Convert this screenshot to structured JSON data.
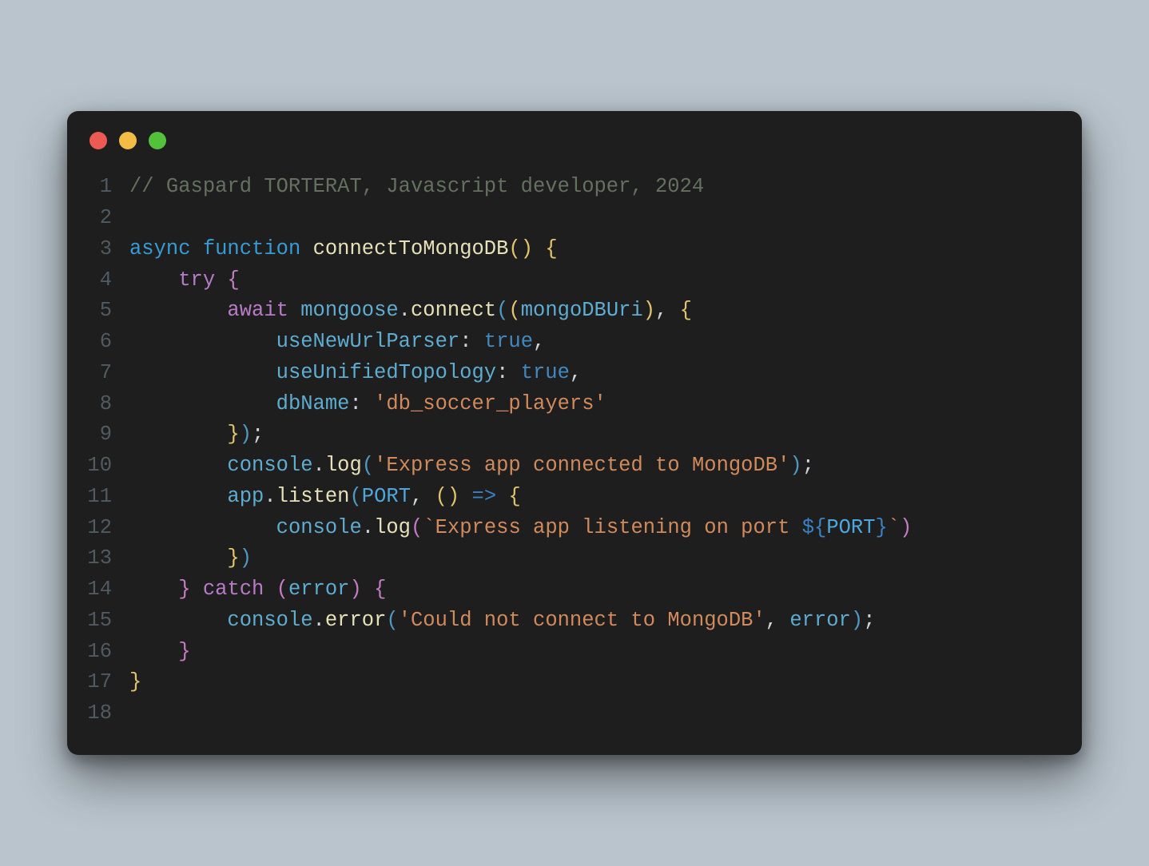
{
  "traffic_lights": {
    "red": "#ec5a53",
    "yellow": "#f1bd44",
    "green": "#54c13d"
  },
  "line_numbers": [
    "1",
    "2",
    "3",
    "4",
    "5",
    "6",
    "7",
    "8",
    "9",
    "10",
    "11",
    "12",
    "13",
    "14",
    "15",
    "16",
    "17",
    "18"
  ],
  "code": {
    "l1_comment": "// Gaspard TORTERAT, Javascript developer, 2024",
    "l3_async": "async",
    "l3_function": "function",
    "l3_name": "connectToMongoDB",
    "l3_parens": "()",
    "l3_brace": " {",
    "l4_try": "try",
    "l4_brace": " {",
    "l5_await": "await",
    "l5_mongoose": "mongoose",
    "l5_dot": ".",
    "l5_connect": "connect",
    "l5_open": "((",
    "l5_uri": "mongoDBUri",
    "l5_close_open": "), {",
    "l6_key": "useNewUrlParser",
    "l6_colon": ": ",
    "l6_val": "true",
    "l6_comma": ",",
    "l7_key": "useUnifiedTopology",
    "l7_colon": ": ",
    "l7_val": "true",
    "l7_comma": ",",
    "l8_key": "dbName",
    "l8_colon": ": ",
    "l8_val": "'db_soccer_players'",
    "l9_close": "});",
    "l10_console": "console",
    "l10_dot": ".",
    "l10_log": "log",
    "l10_p1": "(",
    "l10_str": "'Express app connected to MongoDB'",
    "l10_p2": ");",
    "l11_app": "app",
    "l11_dot": ".",
    "l11_listen": "listen",
    "l11_p1": "(",
    "l11_port": "PORT",
    "l11_comma": ", ",
    "l11_arrowp": "()",
    "l11_arrow": " => ",
    "l11_brace": "{",
    "l12_console": "console",
    "l12_dot": ".",
    "l12_log": "log",
    "l12_p1": "(",
    "l12_tick1": "`",
    "l12_str1": "Express app listening on port ",
    "l12_int_open": "${",
    "l12_port": "PORT",
    "l12_int_close": "}",
    "l12_tick2": "`",
    "l12_p2": ")",
    "l13_close": "})",
    "l14_brace_close": "}",
    "l14_catch": "catch",
    "l14_paren_o": " (",
    "l14_error": "error",
    "l14_paren_c": ")",
    "l14_brace_o": " {",
    "l15_console": "console",
    "l15_dot": ".",
    "l15_error_m": "error",
    "l15_p1": "(",
    "l15_str": "'Could not connect to MongoDB'",
    "l15_comma": ", ",
    "l15_err": "error",
    "l15_p2": ");",
    "l16_brace": "}",
    "l17_brace": "}"
  }
}
